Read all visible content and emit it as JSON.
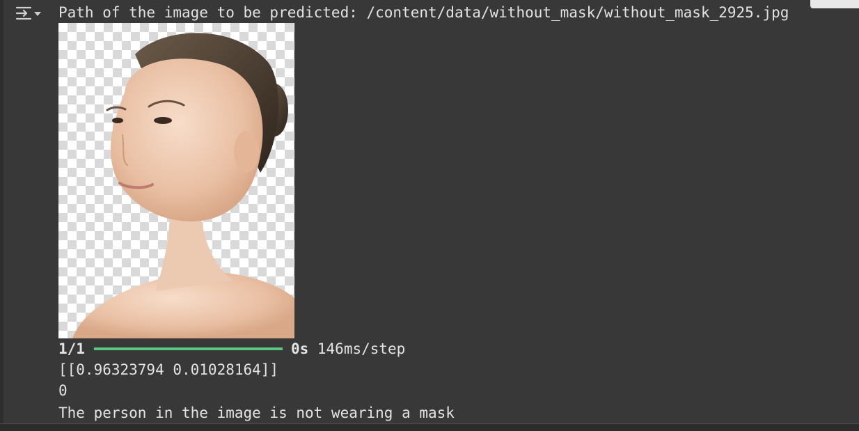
{
  "output": {
    "path_line": "Path of the image to be predicted: /content/data/without_mask/without_mask_2925.jpg",
    "progress": {
      "step": "1/1",
      "fraction": 1.0,
      "time": "0s",
      "rate": "146ms/step"
    },
    "probabilities": "[[0.96323794 0.01028164]]",
    "predicted_class": "0",
    "message": "The person in the image is not wearing a mask"
  },
  "icons": {
    "toggle": "output-collapse-icon"
  },
  "colors": {
    "background": "#383838",
    "text": "#e3e3e3",
    "progress": "#58c47f"
  }
}
